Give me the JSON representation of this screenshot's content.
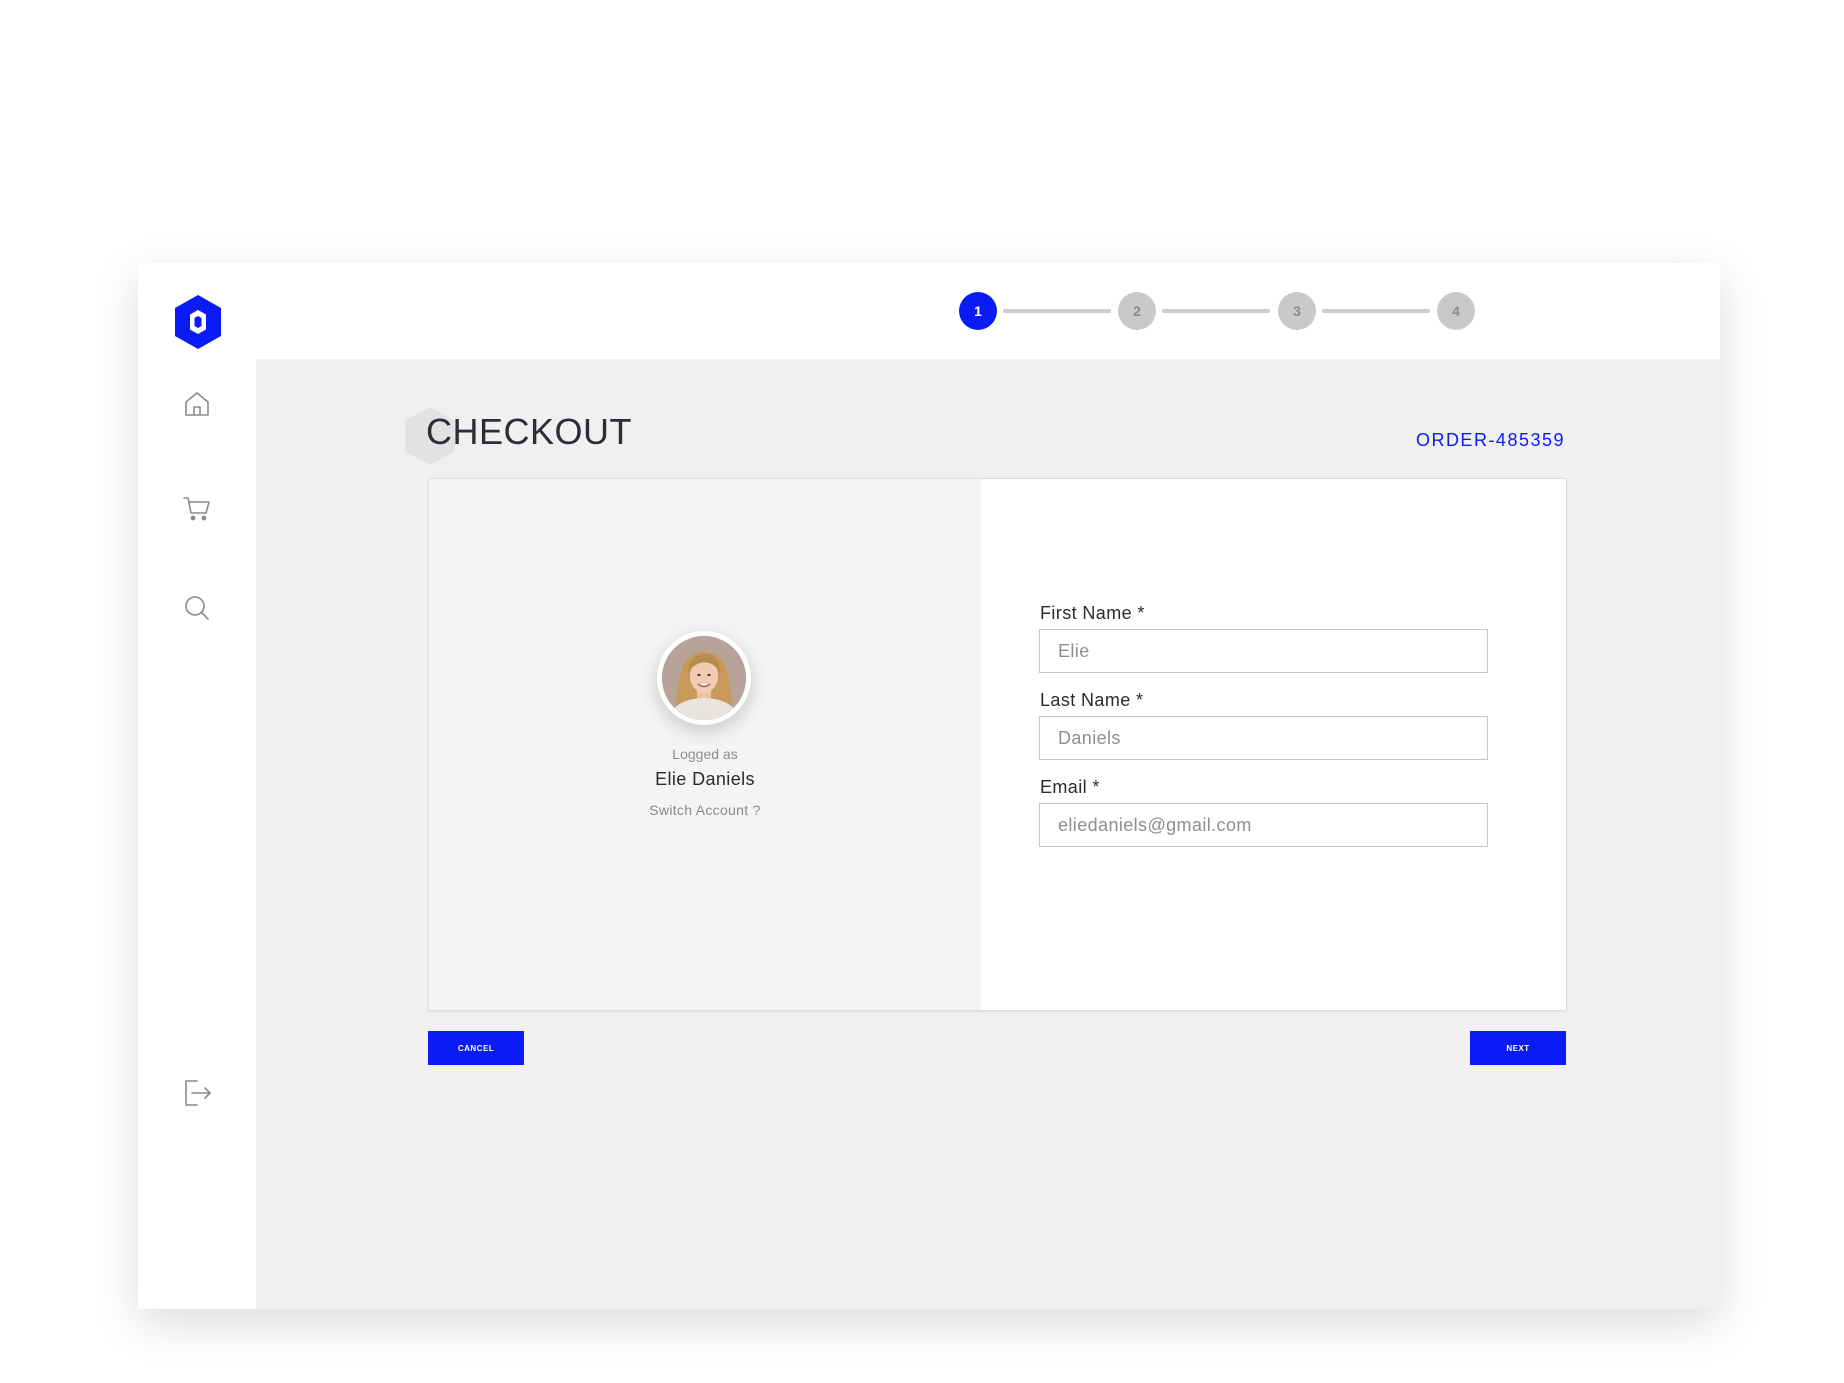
{
  "stepper": {
    "steps": [
      {
        "label": "1",
        "active": true
      },
      {
        "label": "2",
        "active": false
      },
      {
        "label": "3",
        "active": false
      },
      {
        "label": "4",
        "active": false
      }
    ]
  },
  "page": {
    "title": "CHECKOUT",
    "order_id": "ORDER-485359"
  },
  "sidebar": {
    "logo_icon": "hexagon-logo-icon",
    "items": [
      {
        "icon": "home-icon"
      },
      {
        "icon": "cart-icon"
      },
      {
        "icon": "search-icon"
      }
    ],
    "logout_icon": "logout-icon"
  },
  "account": {
    "logged_as_label": "Logged as",
    "name": "Elie Daniels",
    "switch_label": "Switch Account ?"
  },
  "form": {
    "first_name": {
      "label": "First Name *",
      "value": "Elie"
    },
    "last_name": {
      "label": "Last Name *",
      "value": "Daniels"
    },
    "email": {
      "label": "Email *",
      "value": "eliedaniels@gmail.com"
    }
  },
  "actions": {
    "cancel_label": "CANCEL",
    "next_label": "NEXT"
  },
  "colors": {
    "accent": "#0a1bf5",
    "inactive_step": "#c9c9c9",
    "background": "#f0f0f0"
  }
}
